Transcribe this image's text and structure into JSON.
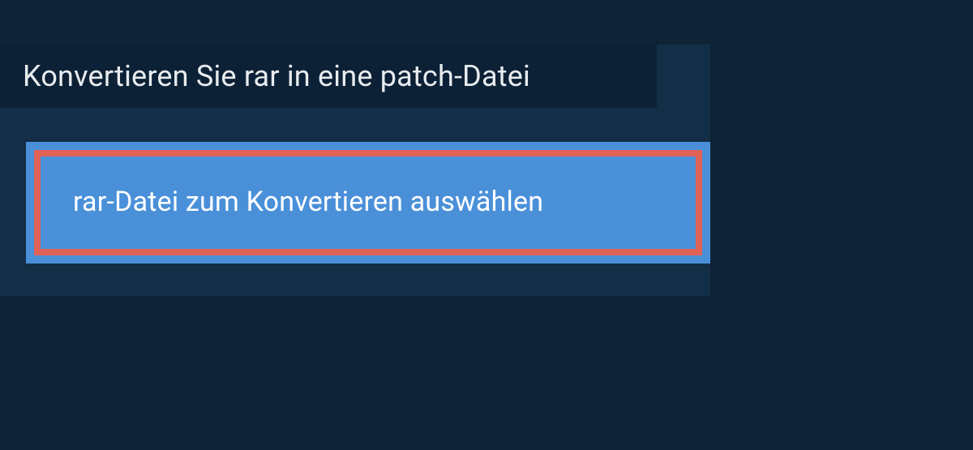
{
  "heading": "Konvertieren Sie rar in eine patch-Datei",
  "button": {
    "label": "rar-Datei zum Konvertieren auswählen"
  }
}
